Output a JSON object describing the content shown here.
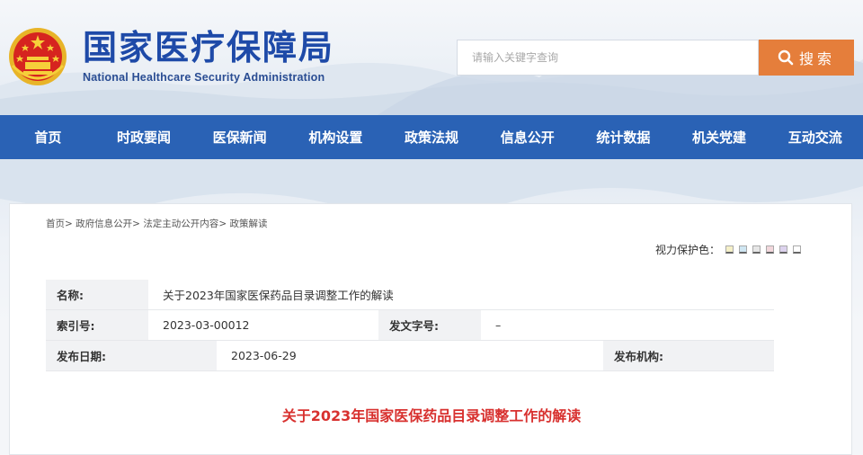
{
  "header": {
    "site_title": "国家医疗保障局",
    "site_subtitle": "National Healthcare Security Administration",
    "search_placeholder": "请输入关键字查询",
    "search_button_label": "搜索"
  },
  "nav": {
    "items": [
      {
        "label": "首页"
      },
      {
        "label": "时政要闻"
      },
      {
        "label": "医保新闻"
      },
      {
        "label": "机构设置"
      },
      {
        "label": "政策法规"
      },
      {
        "label": "信息公开"
      },
      {
        "label": "统计数据"
      },
      {
        "label": "机关党建"
      },
      {
        "label": "互动交流"
      }
    ]
  },
  "breadcrumb": {
    "items": [
      "首页",
      "政府信息公开",
      "法定主动公开内容",
      "政策解读"
    ],
    "separator": ">"
  },
  "eye_care": {
    "label": "视力保护色：",
    "swatches": [
      "#f5f0c8",
      "#cfe6f2",
      "#e6e6e6",
      "#f2d7dc",
      "#ddd3ee",
      "#ffffff"
    ]
  },
  "meta": {
    "name_label": "名称:",
    "name_value": "关于2023年国家医保药品目录调整工作的解读",
    "index_label": "索引号:",
    "index_value": "2023-03-00012",
    "doc_no_label": "发文字号:",
    "doc_no_value": "–",
    "date_label": "发布日期:",
    "date_value": "2023-06-29",
    "issuer_label": "发布机构:",
    "issuer_value": ""
  },
  "article": {
    "title": "关于2023年国家医保药品目录调整工作的解读"
  },
  "colors": {
    "brand_blue": "#1e4aa8",
    "nav_blue": "#2a62b5",
    "search_orange": "#e57e3b",
    "title_red": "#d8312f"
  },
  "icons": {
    "emblem": "national-emblem-icon",
    "search": "search-icon"
  }
}
